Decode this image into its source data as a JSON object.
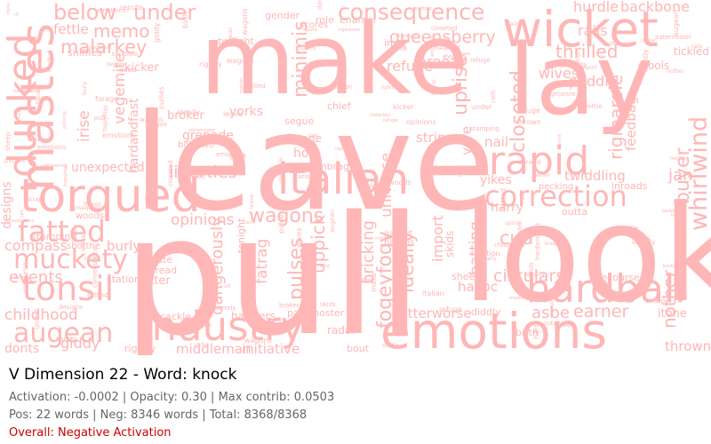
{
  "header": {
    "title": "V Dimension 22 - Word: knock",
    "stats_line": "Activation: -0.0002 | Opacity: 0.30 | Max contrib: 0.0503",
    "count_line": "Pos: 22 words | Neg: 8346 words | Total: 8368/8368",
    "overall": "Overall: Negative Activation"
  },
  "colors": {
    "word_color": "#ffb6b6",
    "title_color": "#000000",
    "stats_color": "#666666",
    "overall_color": "#cc0000"
  },
  "cloud": {
    "words": [
      "leave",
      "pull",
      "make",
      "lay",
      "look",
      "wicket",
      "mastes",
      "dunked",
      "torqued",
      "italian",
      "hardball",
      "emotions",
      "industry",
      "rapid",
      "correction",
      "tonsil",
      "muckety",
      "fatted",
      "augean",
      "childhood",
      "consequence",
      "below",
      "under",
      "fettle",
      "memo",
      "malarkey",
      "minimis",
      "queensberry",
      "breezy",
      "refuge",
      "uprise",
      "rigmarole",
      "whirlwind",
      "buyer",
      "feedbag",
      "thrilled",
      "peddle",
      "backbone",
      "hurdle",
      "closeted",
      "yore",
      "universe",
      "liberties",
      "opinions",
      "wagons",
      "pulses",
      "uppick",
      "bricking",
      "fogeyfogy",
      "ideally",
      "import",
      "batting",
      "cud",
      "havoc",
      "circulars",
      "earner",
      "nother",
      "thrown",
      "betterworse",
      "middleman",
      "initiative",
      "dangerously",
      "fatrag",
      "events",
      "designs",
      "compass",
      "giddy",
      "donts",
      "unexpected",
      "grenade",
      "hob",
      "stripe",
      "nail",
      "yikes",
      "harry",
      "twiddling",
      "jan",
      "burly",
      "tread",
      "utter",
      "hawkers",
      "paternoster",
      "asbe",
      "itone",
      "cackle",
      "rightly",
      "bout",
      "radar",
      "vegemite",
      "hardandfast",
      "irise",
      "broker",
      "yorks",
      "bothtwo",
      "forage",
      "umbrage",
      "segue",
      "chief",
      "ingo",
      "wives",
      "rails",
      "stools",
      "tickled",
      "kicker",
      "sniffles",
      "twilight",
      "gender",
      "role",
      "enamel",
      "scores",
      "tonight",
      "repute",
      "station",
      "stamping",
      "woods",
      "shotthe",
      "outta",
      "inroads",
      "recourse",
      "pecking",
      "barrels",
      "gamut",
      "sheep",
      "diddly",
      "birth",
      "skids",
      "lit"
    ]
  }
}
